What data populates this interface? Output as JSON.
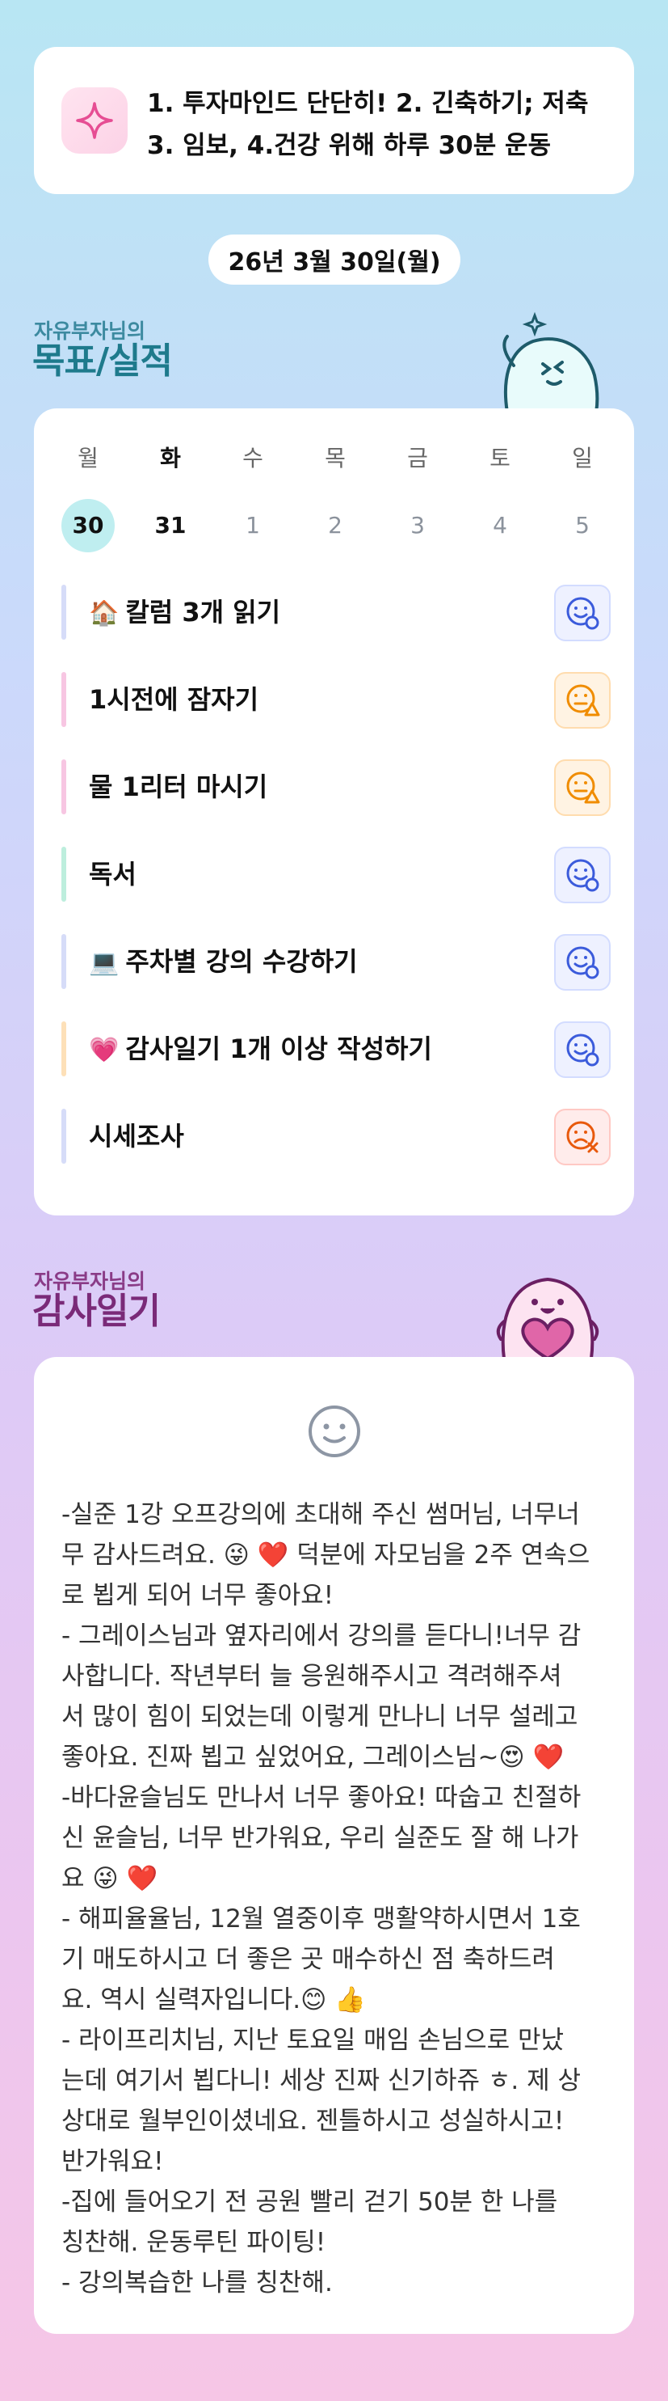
{
  "goal_banner": {
    "icon": "sparkle-icon",
    "line1": "1. 투자마인드 단단히! 2. 긴축하기; 저축",
    "line2": "3. 임보, 4.건강 위해 하루 30분 운동"
  },
  "date_label": "26년 3월 30일(월)",
  "goals_section": {
    "subtitle": "자유부자님의",
    "title": "목표/실적"
  },
  "week": [
    {
      "name": "월",
      "num": "30"
    },
    {
      "name": "화",
      "num": "31"
    },
    {
      "name": "수",
      "num": "1"
    },
    {
      "name": "목",
      "num": "2"
    },
    {
      "name": "금",
      "num": "3"
    },
    {
      "name": "토",
      "num": "4"
    },
    {
      "name": "일",
      "num": "5"
    }
  ],
  "tasks": [
    {
      "emoji": "🏠",
      "label": "칼럼 3개 읽기",
      "bar_color": "#d6dcf8",
      "status": "done-icon"
    },
    {
      "emoji": "",
      "label": "1시전에 잠자기",
      "bar_color": "#f7c6e2",
      "status": "partial-icon"
    },
    {
      "emoji": "",
      "label": "물 1리터 마시기",
      "bar_color": "#f7c6e2",
      "status": "partial-icon"
    },
    {
      "emoji": "",
      "label": "독서",
      "bar_color": "#bdeedd",
      "status": "done-icon"
    },
    {
      "emoji": "💻",
      "label": "주차별 강의 수강하기",
      "bar_color": "#d6dcf8",
      "status": "done-icon"
    },
    {
      "emoji": "💗",
      "label": "감사일기 1개 이상 작성하기",
      "bar_color": "#fde0b8",
      "status": "done-icon"
    },
    {
      "emoji": "",
      "label": "시세조사",
      "bar_color": "#d6dcf8",
      "status": "failed-icon"
    }
  ],
  "diary_section": {
    "subtitle": "자유부자님의",
    "title": "감사일기"
  },
  "diary": {
    "mood_icon": "neutral-smiley-icon",
    "entries": [
      "-실준 1강 오프강의에 초대해 주신 썸머님, 너무너\n무 감사드려요. 😜 ❤️ 덕분에 자모님을 2주 연속으\n로 뵙게 되어 너무 좋아요!",
      "- 그레이스님과 옆자리에서 강의를 듣다니!너무 감\n사합니다. 작년부터 늘 응원해주시고 격려해주셔\n서 많이 힘이 되었는데 이렇게 만나니 너무 설레고\n좋아요. 진짜 뵙고 싶었어요, 그레이스님~😍 ❤️",
      "-바다윤슬님도 만나서 너무 좋아요! 따숩고 친절하\n신 윤슬님, 너무 반가워요, 우리 실준도 잘 해 나가\n요 😜 ❤️",
      "- 해피율율님, 12월 열중이후 맹활약하시면서 1호\n기 매도하시고 더 좋은 곳 매수하신 점 축하드려\n요. 역시 실력자입니다.😊 👍",
      "- 라이프리치님, 지난 토요일 매임 손님으로 만났\n는데 여기서 뵙다니! 세상 진짜 신기하쥬 ㅎ. 제 상\n상대로 월부인이셨네요. 젠틀하시고 성실하시고!\n반가워요!",
      "-집에 들어오기 전 공원 빨리 걷기 50분 한 나를\n칭찬해. 운동루틴 파이팅!",
      "- 강의복습한 나를 칭찬해."
    ]
  },
  "colors": {
    "today_highlight": "#bfeef0",
    "status_done": "#3b5bdb",
    "status_partial": "#f08c00",
    "status_failed": "#e8590c"
  }
}
